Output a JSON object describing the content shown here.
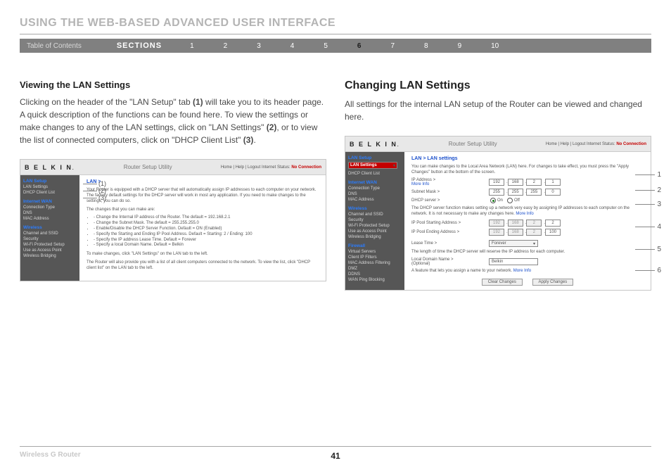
{
  "header": {
    "title": "USING THE WEB-BASED ADVANCED USER INTERFACE"
  },
  "nav": {
    "toc": "Table of Contents",
    "sections": "SECTIONS",
    "numbers": [
      "1",
      "2",
      "3",
      "4",
      "5",
      "6",
      "7",
      "8",
      "9",
      "10"
    ],
    "current": "6"
  },
  "left": {
    "title": "Viewing the LAN Settings",
    "body_pre": "Clicking on the header of the \"LAN Setup\" tab ",
    "body_ref1": "(1)",
    "body_mid1": " will take you to its header page. A quick description of the functions can be found here. To view the settings or make changes to any of the LAN settings, click on \"LAN Settings\" ",
    "body_ref2": "(2)",
    "body_mid2": ", or to view the list of connected computers, click on \"DHCP Client List\" ",
    "body_ref3": "(3)",
    "body_post": ".",
    "callouts": [
      "(1)",
      "(2)",
      "(3)"
    ]
  },
  "right": {
    "title": "Changing LAN Settings",
    "body": "All settings for the internal LAN setup of the Router can be viewed and changed here.",
    "callouts": [
      "1",
      "2",
      "3",
      "4",
      "5",
      "6"
    ]
  },
  "utility": {
    "brand": "B E L K I N",
    "title": "Router Setup Utility",
    "links": "Home |  Help |  Logout   Internet Status: ",
    "status": "No Connection"
  },
  "sidenav": {
    "groups": [
      {
        "label": "LAN Setup",
        "items": [
          "LAN Settings",
          "DHCP Client List"
        ]
      },
      {
        "label": "Internet WAN",
        "items": [
          "Connection Type",
          "DNS",
          "MAC Address"
        ]
      },
      {
        "label": "Wireless",
        "items": [
          "Channel and SSID",
          "Security",
          "Wi-Fi Protected Setup",
          "Use as Access Point",
          "Wireless Bridging"
        ]
      },
      {
        "label": "Firewall",
        "items": [
          "Virtual Servers",
          "Client IP Filters",
          "MAC Address Filtering",
          "DMZ",
          "DDNS",
          "WAN Ping Blocking"
        ]
      }
    ]
  },
  "panel1": {
    "crumb": "LAN >",
    "p1": "Your Router is equipped with a DHCP server that will automatically assign IP addresses to each computer on your network. The factory default settings for the DHCP server will work in most any application. If you need to make changes to the settings, you can do so.",
    "p2": "The changes that you can make are:",
    "bullets": [
      "- Change the Internal IP address of the Router. The default = 192.168.2.1",
      "- Change the Subnet Mask. The default = 255.255.255.0",
      "- Enable/Disable the DHCP Server Function. Default = ON (Enabled)",
      "- Specify the Starting and Ending IP Pool Address. Default = Starting: 2 / Ending: 100",
      "- Specify the IP address Lease Time. Default = Forever",
      "- Specify a local Domain Name. Default = Belkin"
    ],
    "p3": "To make changes, click \"LAN Settings\" on the LAN tab to the left.",
    "p4": "The Router will also provide you with a list of all client computers connected to the network. To view the list, click \"DHCP client list\" on the LAN tab to the left."
  },
  "panel2": {
    "crumb": "LAN > LAN settings",
    "intro": "You can make changes to the Local Area Network (LAN) here. For changes to take effect, you must press the \"Apply Changes\" button at the bottom of the screen.",
    "fields": {
      "ip_label": "IP Address >",
      "ip": [
        "192",
        "168",
        "2",
        "1"
      ],
      "subnet_label": "Subnet Mask >",
      "subnet": [
        "255",
        "255",
        "255",
        "0"
      ],
      "dhcp_label": "DHCP server >",
      "dhcp_on": "On",
      "dhcp_off": "Off",
      "dhcp_note_a": "The DHCP server function makes setting up a network very easy by assigning IP addresses to each computer on the network. It is not necessary to make any changes here. ",
      "start_label": "IP Pool Starting Address >",
      "start": [
        "192",
        "168",
        "2",
        "2"
      ],
      "end_label": "IP Pool Ending Address >",
      "end": [
        "192",
        "168",
        "2",
        "100"
      ],
      "lease_label": "Lease Time >",
      "lease_value": "Forever",
      "lease_note": "The length of time the DHCP server will reserve the IP address for each computer.",
      "domain_label": "Local Domain Name >",
      "domain_opt": "(Optional)",
      "domain_value": "Belkin",
      "domain_note_a": "A feature that lets you assign a name to your network. ",
      "more": "More Info"
    },
    "buttons": {
      "clear": "Clear Changes",
      "apply": "Apply Changes"
    }
  },
  "footer": {
    "product": "Wireless G Router",
    "pageno": "41"
  }
}
